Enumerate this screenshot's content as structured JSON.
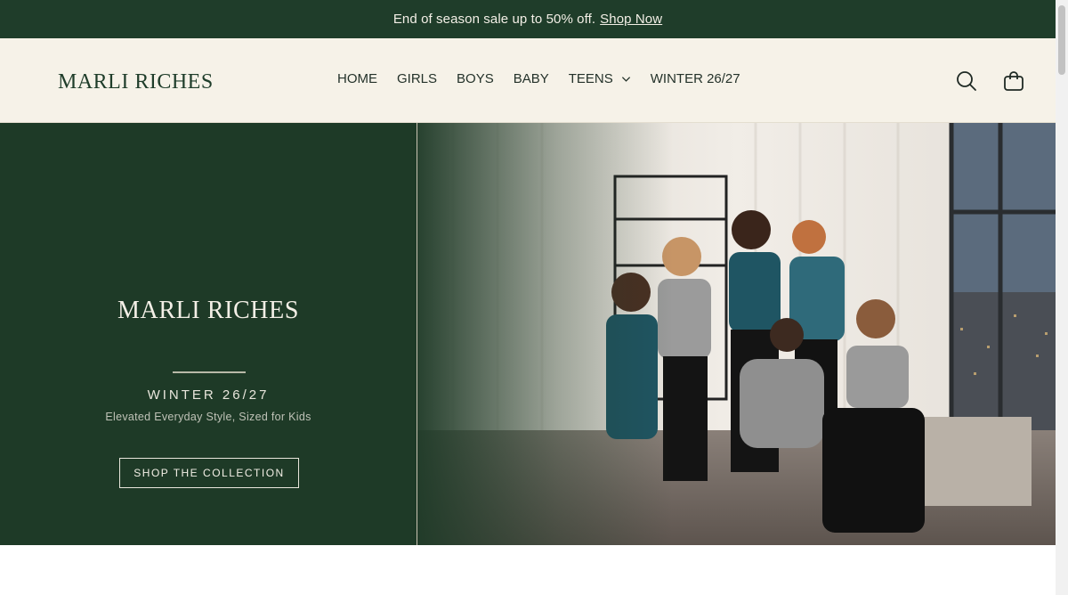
{
  "announcement": {
    "text": "End of season sale up to 50% off.",
    "link_label": "Shop Now"
  },
  "header": {
    "logo": "MARLI RICHES",
    "nav": [
      {
        "label": "HOME"
      },
      {
        "label": "GIRLS"
      },
      {
        "label": "BOYS"
      },
      {
        "label": "BABY"
      },
      {
        "label": "TEENS",
        "has_dropdown": true
      },
      {
        "label": "WINTER 26/27"
      }
    ],
    "icons": [
      "search-icon",
      "shopping-bag-icon"
    ]
  },
  "hero": {
    "brand": "MARLI RICHES",
    "season": "WINTER  26/27",
    "tagline": "Elevated Everyday Style, Sized for Kids",
    "cta_label": "SHOP THE COLLECTION",
    "photo_description_icon": "hero-photo"
  },
  "colors": {
    "brand_green": "#1f3d2a",
    "header_bg": "#f6f2e8",
    "hero_green": "#1e3a27",
    "cream_text": "#f3efe6"
  }
}
